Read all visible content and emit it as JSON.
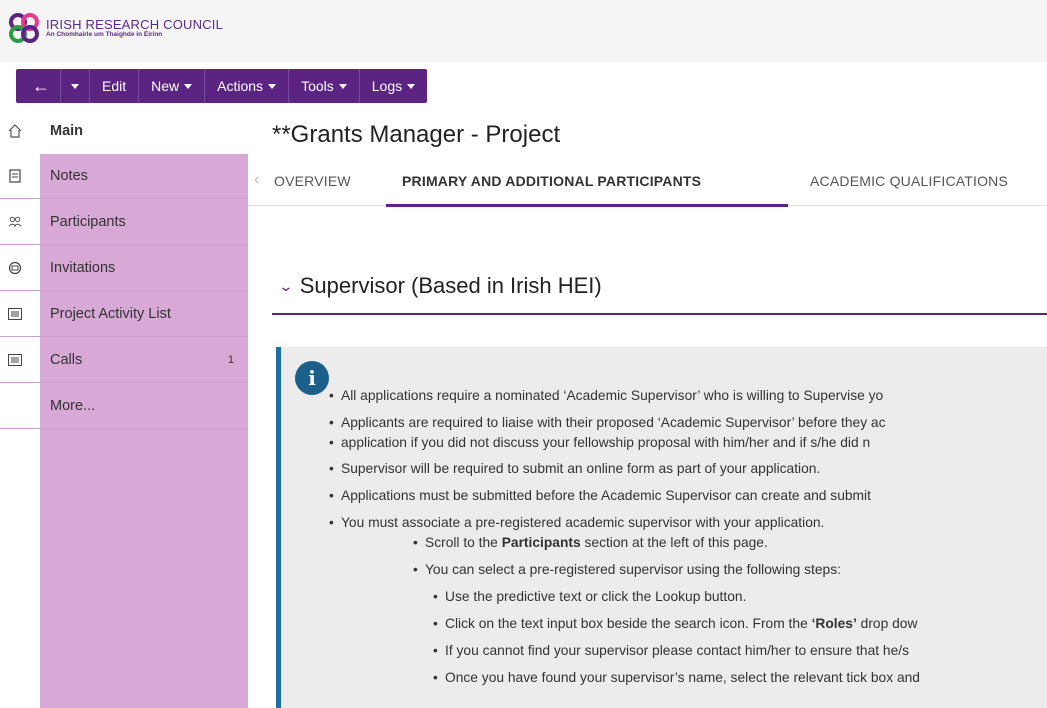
{
  "brand": {
    "title": "IRISH RESEARCH COUNCIL",
    "subtitle": "An Chomhairle um Thaighde in Éirinn"
  },
  "toolbar": {
    "back_label": "←",
    "edit_label": "Edit",
    "new_label": "New",
    "actions_label": "Actions",
    "tools_label": "Tools",
    "logs_label": "Logs"
  },
  "sidebar": {
    "items": [
      {
        "label": "Main",
        "icon": "home-icon"
      },
      {
        "label": "Notes",
        "icon": "document-icon"
      },
      {
        "label": "Participants",
        "icon": "people-icon"
      },
      {
        "label": "Invitations",
        "icon": "invitation-icon"
      },
      {
        "label": "Project Activity List",
        "icon": "list-icon"
      },
      {
        "label": "Calls",
        "icon": "list-icon",
        "count": "1"
      },
      {
        "label": "More...",
        "icon": ""
      }
    ]
  },
  "page": {
    "title": "**Grants Manager - Project"
  },
  "tabs": [
    {
      "label": "OVERVIEW"
    },
    {
      "label": "PRIMARY AND ADDITIONAL PARTICIPANTS",
      "active": true
    },
    {
      "label": "ACADEMIC QUALIFICATIONS"
    }
  ],
  "section": {
    "title": "Supervisor (Based in Irish HEI)"
  },
  "info": {
    "items": [
      "All applications require a nominated ‘Academic Supervisor’ who is willing to Supervise yo",
      "Applicants are required to liaise with their proposed ‘Academic Supervisor’ before they ac",
      "application if you did not discuss your fellowship proposal with him/her and if s/he did n",
      "Supervisor will be required to submit an online form as part of your application.",
      "Applications must be submitted before the Academic Supervisor can create and submit",
      "You must associate a pre-registered academic supervisor with your application.",
      "Scroll to the ",
      "Participants",
      " section at the left of this page.",
      "You can select a pre-registered supervisor using the following steps:",
      "Use the predictive text or click the Lookup button.",
      "Click on the text input box beside the search icon. From the ",
      "‘Roles’",
      " drop dow",
      "If you cannot find your supervisor please contact him/her to ensure that he/s",
      "Once you have found your supervisor’s name, select the relevant tick box and"
    ]
  },
  "colors": {
    "brand_purple": "#5c2482",
    "sidebar_pink": "#d8a8d6",
    "info_blue": "#1c6ea4"
  }
}
